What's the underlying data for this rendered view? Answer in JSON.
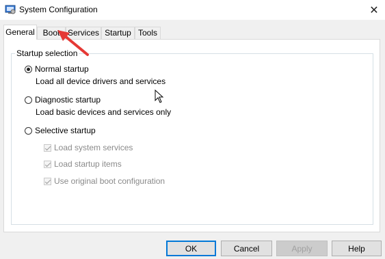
{
  "window": {
    "title": "System Configuration",
    "close_glyph": "✕"
  },
  "tabs": [
    {
      "label": "General",
      "active": true
    },
    {
      "label": "Boot",
      "active": false
    },
    {
      "label": "Services",
      "active": false
    },
    {
      "label": "Startup",
      "active": false
    },
    {
      "label": "Tools",
      "active": false
    }
  ],
  "startup": {
    "legend": "Startup selection",
    "normal": {
      "label": "Normal startup",
      "desc": "Load all device drivers and services",
      "checked": true
    },
    "diagnostic": {
      "label": "Diagnostic startup",
      "desc": "Load basic devices and services only",
      "checked": false
    },
    "selective": {
      "label": "Selective startup",
      "checked": false
    },
    "options": [
      {
        "label": "Load system services",
        "checked": true
      },
      {
        "label": "Load startup items",
        "checked": true
      },
      {
        "label": "Use original boot configuration",
        "checked": true
      }
    ]
  },
  "buttons": {
    "ok": "OK",
    "cancel": "Cancel",
    "apply": "Apply",
    "help": "Help"
  },
  "colors": {
    "annotation_arrow": "#e53935",
    "focus_border": "#0078d7"
  }
}
